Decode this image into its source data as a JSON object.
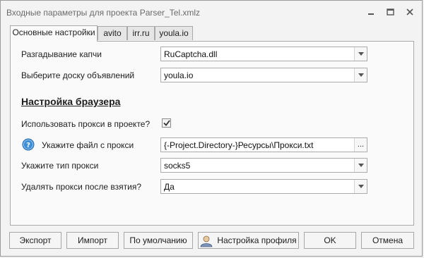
{
  "window": {
    "title": "Входные параметры для проекта Parser_Tel.xmlz"
  },
  "tabs": [
    {
      "label": "Основные настройки",
      "active": true
    },
    {
      "label": "avito",
      "active": false
    },
    {
      "label": "irr.ru",
      "active": false
    },
    {
      "label": "youla.io",
      "active": false
    }
  ],
  "form": {
    "captcha": {
      "label": "Разгадывание капчи",
      "value": "RuCaptcha.dll"
    },
    "board": {
      "label": "Выберите доску объявлений",
      "value": "youla.io"
    },
    "browser_heading": "Настройка браузера",
    "use_proxy": {
      "label": "Использовать прокси в проекте?",
      "checked": true
    },
    "proxy_file": {
      "label": "Укажите файл с прокси",
      "value": "{-Project.Directory-}Ресурсы\\Прокси.txt",
      "browse": "..."
    },
    "proxy_type": {
      "label": "Укажите тип прокси",
      "value": "socks5"
    },
    "delete_proxy": {
      "label": "Удалять прокси после взятия?",
      "value": "Да"
    }
  },
  "buttons": {
    "export": "Экспорт",
    "import": "Импорт",
    "default": "По умолчанию",
    "profile": "Настройка профиля",
    "ok": "OK",
    "cancel": "Отмена"
  },
  "icons": {
    "help": "question-circle-icon",
    "profile": "user-profile-icon",
    "minimize": "minimize-icon",
    "maximize": "maximize-icon",
    "close": "close-icon"
  },
  "colors": {
    "help_icon": "#3d8ed8",
    "panel": "#fafafa",
    "window": "#f3f3f3"
  }
}
